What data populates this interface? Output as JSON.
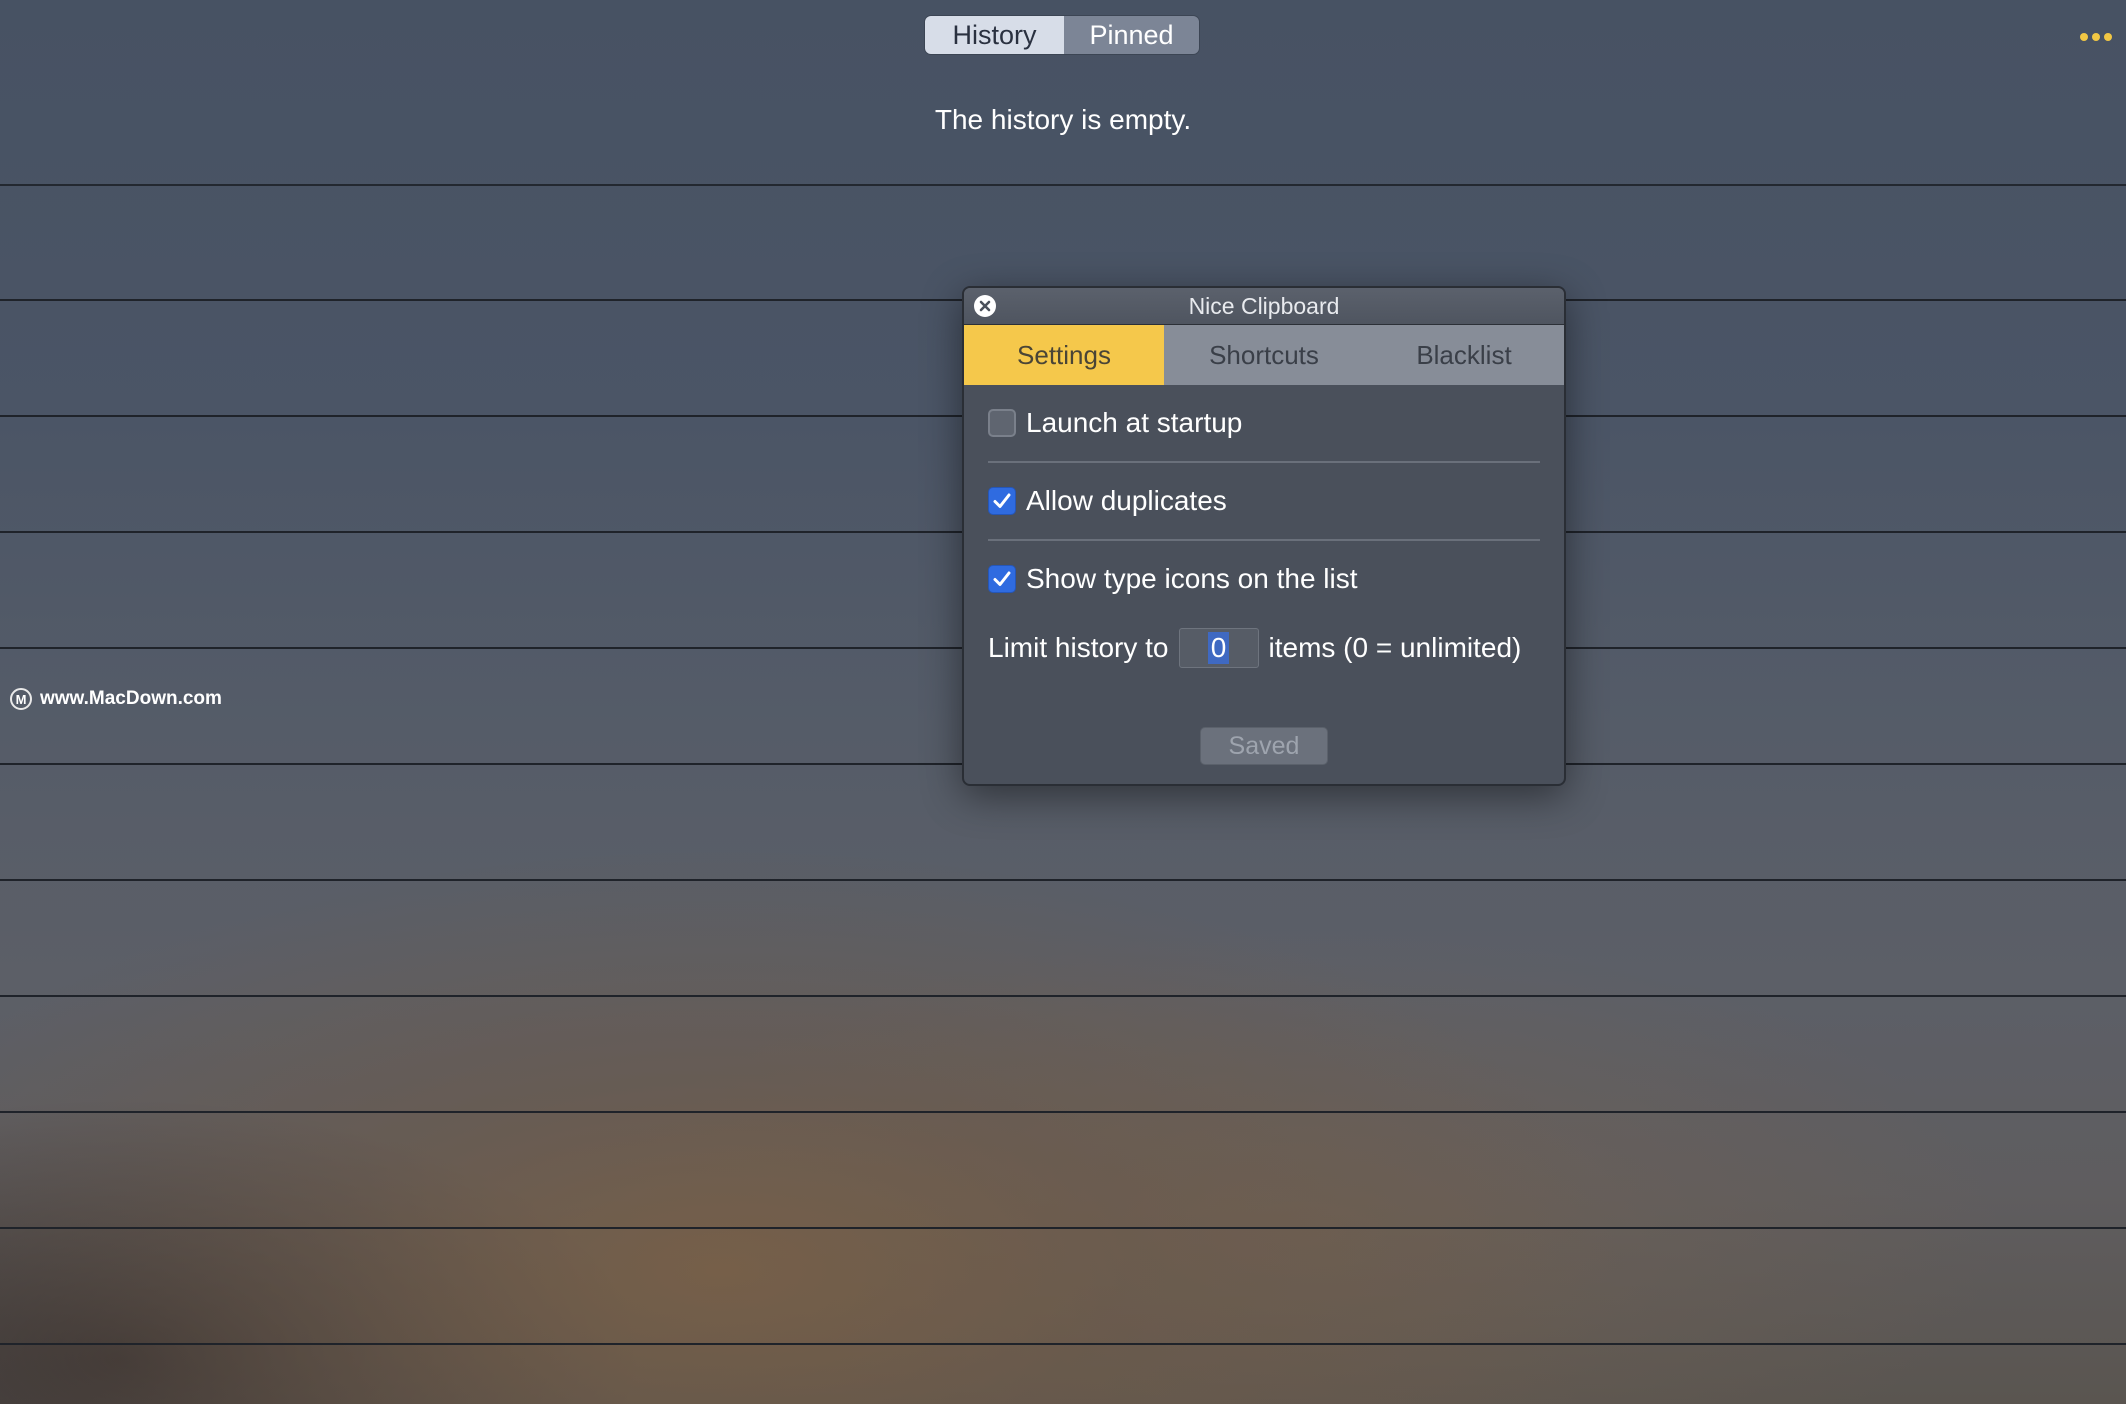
{
  "main_window": {
    "segments": [
      {
        "label": "History",
        "selected": true
      },
      {
        "label": "Pinned",
        "selected": false
      }
    ],
    "more_icon": "ellipsis-icon",
    "empty_message": "The history is empty."
  },
  "watermark": {
    "text": "www.MacDown.com"
  },
  "dialog": {
    "title": "Nice Clipboard",
    "close_icon": "close-icon",
    "tabs": [
      {
        "label": "Settings",
        "active": true
      },
      {
        "label": "Shortcuts",
        "active": false
      },
      {
        "label": "Blacklist",
        "active": false
      }
    ],
    "options": [
      {
        "label": "Launch at startup",
        "checked": false
      },
      {
        "label": "Allow duplicates",
        "checked": true
      },
      {
        "label": "Show type icons on the list",
        "checked": true
      }
    ],
    "limit": {
      "prefix": "Limit history to",
      "value": "0",
      "suffix": "items (0 = unlimited)"
    },
    "saved_label": "Saved"
  },
  "colors": {
    "accent_tab": "#f5c84b",
    "checkbox_checked": "#2f6be0",
    "more_dots": "#f2c744"
  }
}
